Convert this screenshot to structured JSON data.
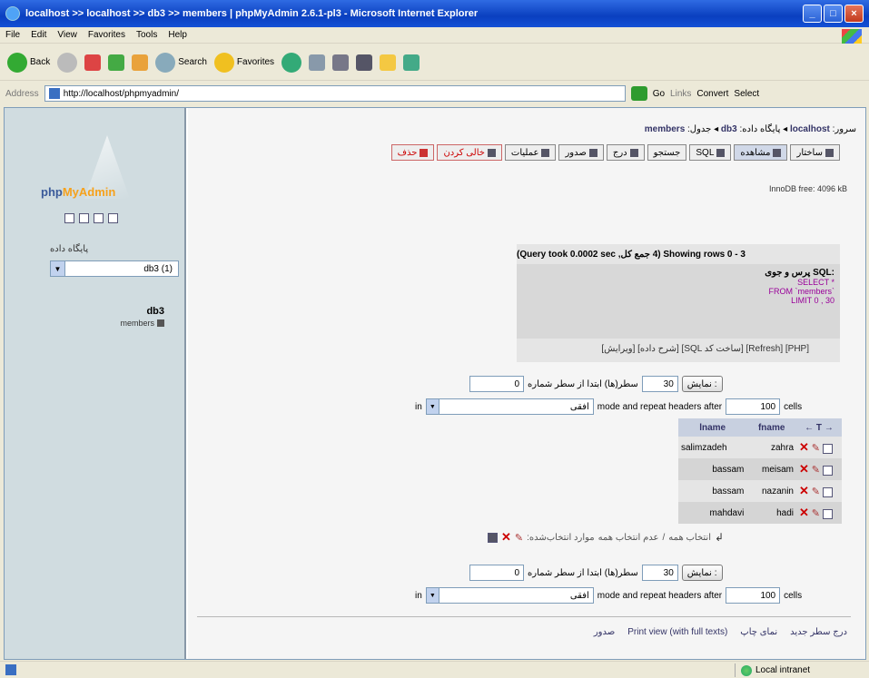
{
  "window": {
    "title": "localhost >> localhost >> db3 >> members | phpMyAdmin 2.6.1-pl3 - Microsoft Internet Explorer",
    "min": "_",
    "max": "□",
    "close": "×"
  },
  "menubar": [
    "File",
    "Edit",
    "View",
    "Favorites",
    "Tools",
    "Help"
  ],
  "toolbar": {
    "back": "Back",
    "search": "Search",
    "favorites": "Favorites"
  },
  "addressbar": {
    "label": "Address",
    "url": "http://localhost/phpmyadmin/",
    "go": "Go",
    "links": "Links",
    "convert": "Convert",
    "select": "Select"
  },
  "sidebar": {
    "logo_part1": "php",
    "logo_part2": "MyAdmin",
    "db_label": "پایگاه داده",
    "db_value": "db3 (1)",
    "db_name": "db3",
    "table_name": "members"
  },
  "breadcrumb": {
    "server_label": "سرور:",
    "server": "localhost",
    "db_label": "پایگاه داده:",
    "db": "db3",
    "table_label": "جدول:",
    "table": "members"
  },
  "tabs": [
    "ساختار",
    "مشاهده",
    "SQL",
    "جستجو",
    "درج",
    "صدور",
    "عملیات",
    "خالی کردن",
    "حذف"
  ],
  "row_info": "InnoDB free: 4096 kB",
  "result": {
    "header": "Showing rows 0 - 3 (4 جمع کل, Query took 0.0002 sec)",
    "sql_label": "پرس و جوی SQL:",
    "sql_line1": "SELECT *",
    "sql_line2": "FROM `members`",
    "sql_line3": "LIMIT 0 , 30",
    "links": "[ویرایش] [شرح داده] [SQL ساخت کد] [Refresh] [PHP]"
  },
  "nav": {
    "show_button": "نمایش :",
    "rows_value": "30",
    "rows_text": "سطر(ها) ابتدا از سطر شماره",
    "start_value": "0",
    "mode_value": "افقی",
    "mode_text": "mode and repeat headers after",
    "cells_value": "100",
    "cells_text": "cells",
    "in_text": "in"
  },
  "grid": {
    "columns": [
      "fname",
      "lname"
    ],
    "rows": [
      {
        "fname": "zahra",
        "lname": "salimzadeh"
      },
      {
        "fname": "meisam",
        "lname": "bassam"
      },
      {
        "fname": "nazanin",
        "lname": "bassam"
      },
      {
        "fname": "hadi",
        "lname": "mahdavi"
      }
    ]
  },
  "bulk": {
    "check_all": "انتخاب همه",
    "separator": "/",
    "uncheck_all": "عدم انتخاب همه",
    "with_selected": "موارد انتخاب‌شده:"
  },
  "footer": {
    "insert": "درج سطر جدید",
    "print": "نمای چاپ",
    "print_full": "Print view (with full texts)",
    "export": "صدور"
  },
  "status": {
    "zone": "Local intranet"
  }
}
